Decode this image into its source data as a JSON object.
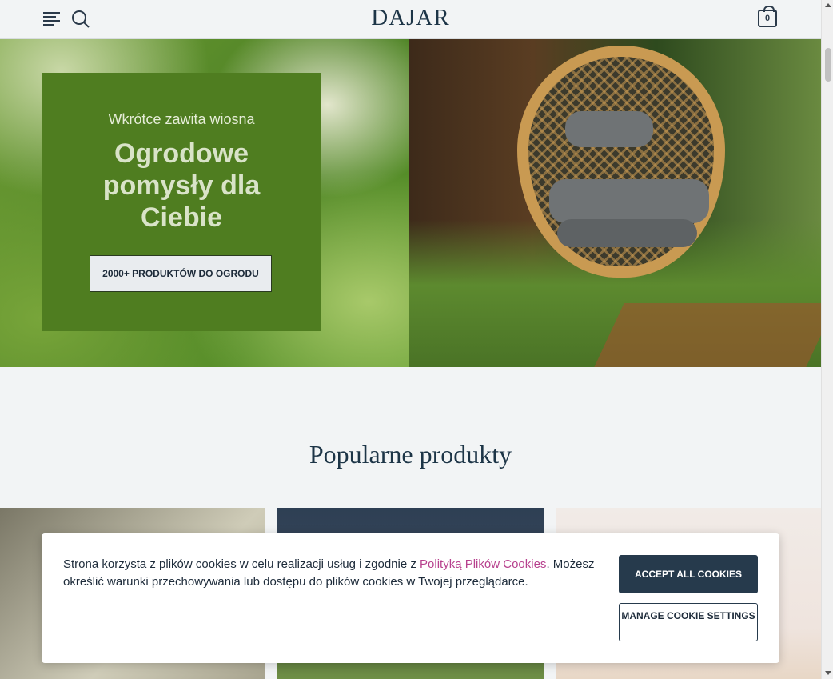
{
  "header": {
    "logo": "DAJAR",
    "cart_count": "0"
  },
  "hero": {
    "subtitle": "Wkrótce zawita wiosna",
    "title": "Ogrodowe pomysły dla Ciebie",
    "button_label": "2000+ PRODUKTÓW DO OGRODU"
  },
  "popular": {
    "title": "Popularne produkty"
  },
  "cookie": {
    "text_before": "Strona korzysta z plików cookies w celu realizacji usług i zgodnie z ",
    "link_text": "Polityką Plików Cookies",
    "text_after": ". Możesz określić warunki przechowywania lub dostępu do plików cookies w Twojej przeglądarce.",
    "accept_label": "ACCEPT ALL COOKIES",
    "manage_label": "MANAGE COOKIE SETTINGS"
  },
  "colors": {
    "primary": "#263a4c",
    "hero_panel": "#4f7d20",
    "link": "#b7418e",
    "background": "#f2f4f5"
  },
  "icons": [
    "menu-icon",
    "search-icon",
    "shopping-bag-icon"
  ]
}
